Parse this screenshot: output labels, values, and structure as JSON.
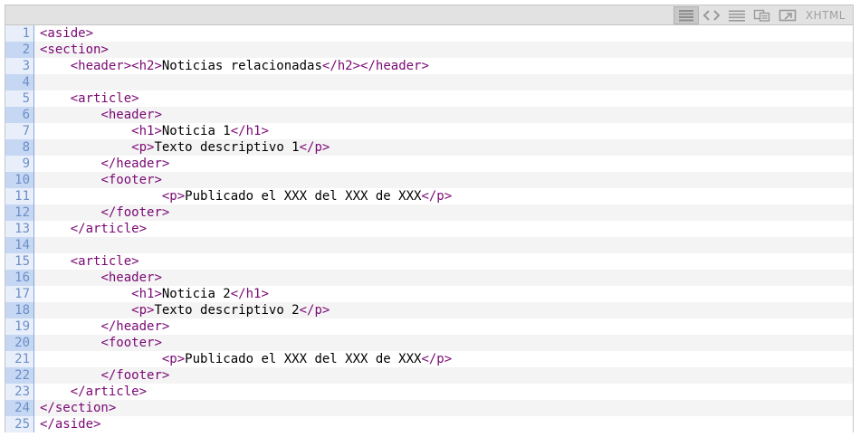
{
  "toolbar": {
    "buttons": [
      {
        "icon": "view-source-icon",
        "active": true
      },
      {
        "icon": "code-brackets-icon",
        "active": false
      },
      {
        "icon": "wrap-lines-icon",
        "active": false
      },
      {
        "icon": "copy-icon",
        "active": false
      },
      {
        "icon": "popup-window-icon",
        "active": false
      }
    ],
    "language": "XHTML"
  },
  "colors": {
    "tag": "#7a0874",
    "text": "#000000",
    "line_number": "#6d8fc7"
  },
  "lines": [
    {
      "n": "1",
      "text": "<aside>"
    },
    {
      "n": "2",
      "text": "<section>"
    },
    {
      "n": "3",
      "text": "    <header><h2>Noticias relacionadas</h2></header>"
    },
    {
      "n": "4",
      "text": ""
    },
    {
      "n": "5",
      "text": "    <article>"
    },
    {
      "n": "6",
      "text": "        <header>"
    },
    {
      "n": "7",
      "text": "            <h1>Noticia 1</h1>"
    },
    {
      "n": "8",
      "text": "            <p>Texto descriptivo 1</p>"
    },
    {
      "n": "9",
      "text": "        </header>"
    },
    {
      "n": "10",
      "text": "        <footer>"
    },
    {
      "n": "11",
      "text": "                <p>Publicado el XXX del XXX de XXX</p>"
    },
    {
      "n": "12",
      "text": "        </footer>"
    },
    {
      "n": "13",
      "text": "    </article>"
    },
    {
      "n": "14",
      "text": ""
    },
    {
      "n": "15",
      "text": "    <article>"
    },
    {
      "n": "16",
      "text": "        <header>"
    },
    {
      "n": "17",
      "text": "            <h1>Noticia 2</h1>"
    },
    {
      "n": "18",
      "text": "            <p>Texto descriptivo 2</p>"
    },
    {
      "n": "19",
      "text": "        </header>"
    },
    {
      "n": "20",
      "text": "        <footer>"
    },
    {
      "n": "21",
      "text": "                <p>Publicado el XXX del XXX de XXX</p>"
    },
    {
      "n": "22",
      "text": "        </footer>"
    },
    {
      "n": "23",
      "text": "    </article>"
    },
    {
      "n": "24",
      "text": "</section>"
    },
    {
      "n": "25",
      "text": "</aside>"
    }
  ]
}
